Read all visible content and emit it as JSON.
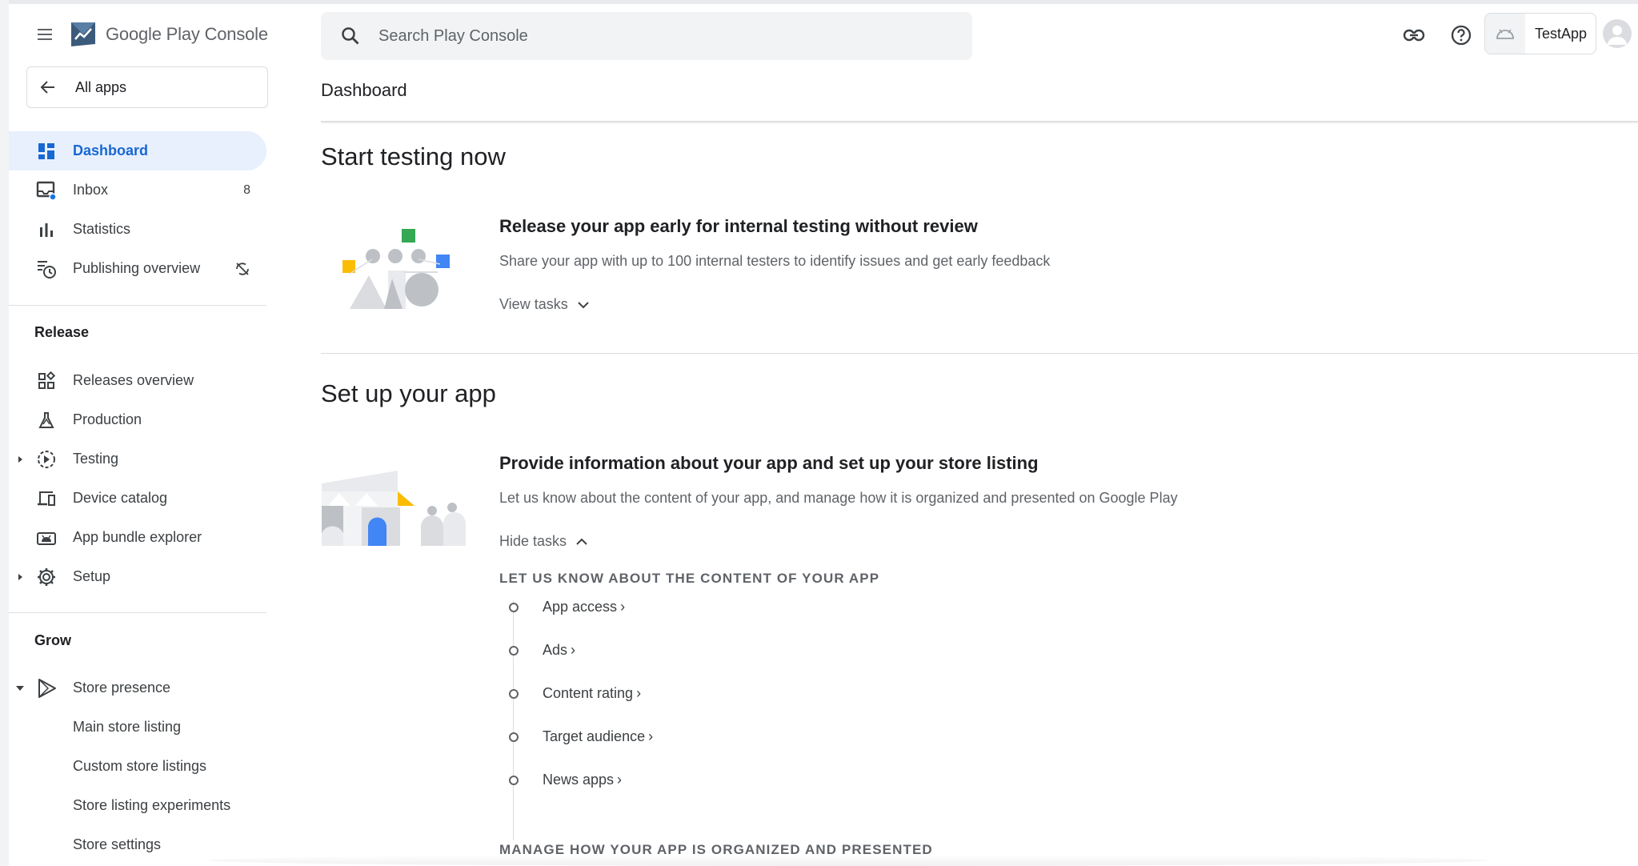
{
  "app": {
    "logo_text_google": "Google Play",
    "logo_text_console": " Console"
  },
  "sidebar": {
    "all_apps_label": "All apps",
    "items": [
      {
        "label": "Dashboard",
        "icon": "dashboard-icon",
        "active": true
      },
      {
        "label": "Inbox",
        "icon": "inbox-icon",
        "count": "8"
      },
      {
        "label": "Statistics",
        "icon": "bar-chart-icon"
      },
      {
        "label": "Publishing overview",
        "icon": "history-icon"
      }
    ],
    "release_heading": "Release",
    "release_items": [
      {
        "label": "Releases overview",
        "icon": "dashboard-outline-icon"
      },
      {
        "label": "Production",
        "icon": "flask-icon"
      },
      {
        "label": "Testing",
        "icon": "play-circle-icon"
      },
      {
        "label": "Device catalog",
        "icon": "devices-icon"
      },
      {
        "label": "App bundle explorer",
        "icon": "android-icon"
      },
      {
        "label": "Setup",
        "icon": "gear-icon"
      }
    ],
    "grow_heading": "Grow",
    "grow_items": [
      {
        "label": "Store presence",
        "icon": "play-icon"
      },
      {
        "label": "Main store listing"
      },
      {
        "label": "Custom store listings"
      },
      {
        "label": "Store listing experiments"
      },
      {
        "label": "Store settings"
      }
    ]
  },
  "header": {
    "search_placeholder": "Search Play Console",
    "app_name": "TestApp"
  },
  "page": {
    "title": "Dashboard"
  },
  "testing_section": {
    "title": "Start testing now",
    "card_title": "Release your app early for internal testing without review",
    "card_desc": "Share your app with up to 100 internal testers to identify issues and get early feedback",
    "toggle_label": "View tasks"
  },
  "setup_section": {
    "title": "Set up your app",
    "card_title": "Provide information about your app and set up your store listing",
    "card_desc": "Let us know about the content of your app, and manage how it is organized and presented on Google Play",
    "toggle_label": "Hide tasks",
    "group1_heading": "LET US KNOW ABOUT THE CONTENT OF YOUR APP",
    "tasks": [
      "App access",
      "Ads",
      "Content rating",
      "Target audience",
      "News apps"
    ],
    "group2_heading": "MANAGE HOW YOUR APP IS ORGANIZED AND PRESENTED"
  },
  "colors": {
    "accent": "#1967d2",
    "active_bg": "#e8f0fe",
    "text_secondary": "#5f6368"
  }
}
